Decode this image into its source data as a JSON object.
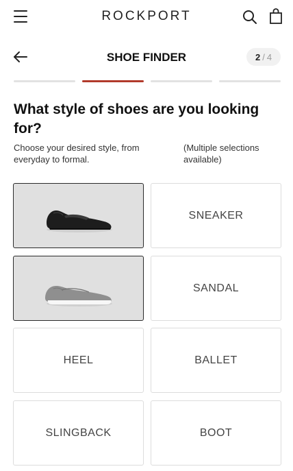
{
  "header": {
    "brand": "ROCKPORT",
    "menu_icon": "hamburger-menu-icon",
    "search_icon": "search-icon",
    "bag_icon": "shopping-bag-icon"
  },
  "finder": {
    "title": "SHOE FINDER",
    "back_icon": "arrow-left-icon",
    "step_current": "2",
    "step_separator": "/",
    "step_total": "4",
    "progress_segments": 4,
    "progress_active_index": 2,
    "accent_color": "#b23a2b"
  },
  "question": {
    "title": "What style of shoes are you looking for?",
    "description": "Choose your desired style, from everyday to formal.",
    "note": "(Multiple selections available)"
  },
  "options": [
    {
      "label": "",
      "image": "black-loafer-image",
      "selected": true
    },
    {
      "label": "SNEAKER",
      "selected": false
    },
    {
      "label": "",
      "image": "gray-slip-on-sneaker-image",
      "selected": true
    },
    {
      "label": "SANDAL",
      "selected": false
    },
    {
      "label": "HEEL",
      "selected": false
    },
    {
      "label": "BALLET",
      "selected": false
    },
    {
      "label": "SLINGBACK",
      "selected": false
    },
    {
      "label": "BOOT",
      "selected": false
    }
  ]
}
